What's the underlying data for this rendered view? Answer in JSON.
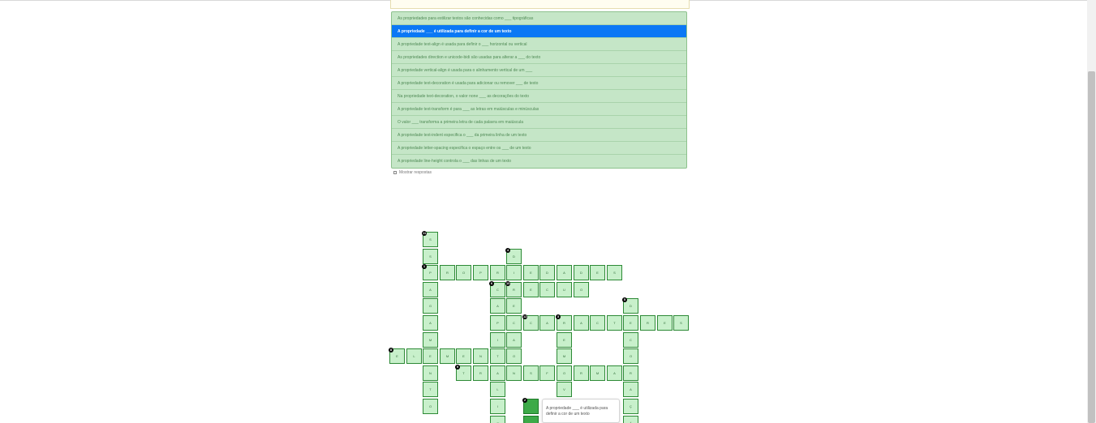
{
  "clues": [
    "As propriedades para estilizar textos são conhecidas como ___ tipográficas",
    "A propriedade ___ é utilizada para definir a cor de um texto",
    "A propriedade text-align é usada para definir o ___ horizontal ou vertical",
    "As propriedades direction e unicode-bidi são usadas para alterar a ___ do texto",
    "A propriedade vertical-align é usada para o alinhamento vertical de um ___",
    "A propriedade text-decoration é usada para adicionar ou remover ___ de texto",
    "Na propriedade text-decoration, o valor none ___ as decorações do texto",
    "A propriedade text-transform é para ___ as letras em maiúsculas e minúsculas",
    "O valor ___ transforma a primeira letra de cada palavra em maiúscula",
    "A propriedade text-indent especifica o ___ da primeira linha de um texto",
    "A propriedade letter-spacing especifica o espaço entre os ___ de um texto",
    "A propriedade line-height controla o ___ das linhas de um texto"
  ],
  "active_clue_index": 1,
  "show_answers_label": "Mostrar respostas",
  "tooltip_text": "A propriedade ___ é utilizada para definir a cor de um texto",
  "colors": {
    "cell_fill": "#c8f0cb",
    "cell_border": "#2d8a36",
    "active_clue": "#0b78f5",
    "focused_cell": "#3daa48"
  },
  "grid": {
    "cells": [
      {
        "c": 2,
        "r": 0,
        "ch": "S",
        "n": "11"
      },
      {
        "c": 2,
        "r": 1,
        "ch": "S"
      },
      {
        "c": 7,
        "r": 1,
        "ch": "D",
        "n": "4"
      },
      {
        "c": 2,
        "r": 2,
        "ch": "P",
        "n": "1"
      },
      {
        "c": 3,
        "r": 2,
        "ch": "R"
      },
      {
        "c": 4,
        "r": 2,
        "ch": "O"
      },
      {
        "c": 5,
        "r": 2,
        "ch": "P"
      },
      {
        "c": 6,
        "r": 2,
        "ch": "R"
      },
      {
        "c": 7,
        "r": 2,
        "ch": "I"
      },
      {
        "c": 8,
        "r": 2,
        "ch": "E"
      },
      {
        "c": 9,
        "r": 2,
        "ch": "D"
      },
      {
        "c": 10,
        "r": 2,
        "ch": "A"
      },
      {
        "c": 11,
        "r": 2,
        "ch": "D"
      },
      {
        "c": 12,
        "r": 2,
        "ch": "E"
      },
      {
        "c": 13,
        "r": 2,
        "ch": "S"
      },
      {
        "c": 2,
        "r": 3,
        "ch": "A"
      },
      {
        "c": 6,
        "r": 3,
        "ch": "C",
        "n": "6"
      },
      {
        "c": 7,
        "r": 3,
        "ch": "R",
        "n": "10"
      },
      {
        "c": 8,
        "r": 3,
        "ch": "E"
      },
      {
        "c": 9,
        "r": 3,
        "ch": "C"
      },
      {
        "c": 10,
        "r": 3,
        "ch": "U"
      },
      {
        "c": 11,
        "r": 3,
        "ch": "O"
      },
      {
        "c": 2,
        "r": 4,
        "ch": "G"
      },
      {
        "c": 6,
        "r": 4,
        "ch": "A"
      },
      {
        "c": 7,
        "r": 4,
        "ch": "E"
      },
      {
        "c": 14,
        "r": 4,
        "ch": "D",
        "n": "5"
      },
      {
        "c": 2,
        "r": 5,
        "ch": "A"
      },
      {
        "c": 6,
        "r": 5,
        "ch": "P"
      },
      {
        "c": 7,
        "r": 5,
        "ch": "C"
      },
      {
        "c": 8,
        "r": 5,
        "ch": "C",
        "n": "12"
      },
      {
        "c": 9,
        "r": 5,
        "ch": "A"
      },
      {
        "c": 10,
        "r": 5,
        "ch": "R",
        "n": "3"
      },
      {
        "c": 11,
        "r": 5,
        "ch": "A"
      },
      {
        "c": 12,
        "r": 5,
        "ch": "C"
      },
      {
        "c": 13,
        "r": 5,
        "ch": "T"
      },
      {
        "c": 14,
        "r": 5,
        "ch": "E"
      },
      {
        "c": 15,
        "r": 5,
        "ch": "R"
      },
      {
        "c": 16,
        "r": 5,
        "ch": "E"
      },
      {
        "c": 17,
        "r": 5,
        "ch": "S"
      },
      {
        "c": 2,
        "r": 6,
        "ch": "M"
      },
      {
        "c": 6,
        "r": 6,
        "ch": "I"
      },
      {
        "c": 7,
        "r": 6,
        "ch": "A"
      },
      {
        "c": 10,
        "r": 6,
        "ch": "E"
      },
      {
        "c": 14,
        "r": 6,
        "ch": "C"
      },
      {
        "c": 0,
        "r": 7,
        "ch": "E",
        "n": "8"
      },
      {
        "c": 1,
        "r": 7,
        "ch": "L"
      },
      {
        "c": 2,
        "r": 7,
        "ch": "E"
      },
      {
        "c": 3,
        "r": 7,
        "ch": "M"
      },
      {
        "c": 4,
        "r": 7,
        "ch": "E"
      },
      {
        "c": 5,
        "r": 7,
        "ch": "N"
      },
      {
        "c": 6,
        "r": 7,
        "ch": "T"
      },
      {
        "c": 7,
        "r": 7,
        "ch": "O"
      },
      {
        "c": 10,
        "r": 7,
        "ch": "M"
      },
      {
        "c": 14,
        "r": 7,
        "ch": "O"
      },
      {
        "c": 2,
        "r": 8,
        "ch": "N"
      },
      {
        "c": 4,
        "r": 8,
        "ch": "T",
        "n": "9"
      },
      {
        "c": 5,
        "r": 8,
        "ch": "R"
      },
      {
        "c": 6,
        "r": 8,
        "ch": "A"
      },
      {
        "c": 7,
        "r": 8,
        "ch": "N"
      },
      {
        "c": 8,
        "r": 8,
        "ch": "S"
      },
      {
        "c": 9,
        "r": 8,
        "ch": "F"
      },
      {
        "c": 10,
        "r": 8,
        "ch": "O"
      },
      {
        "c": 11,
        "r": 8,
        "ch": "R"
      },
      {
        "c": 12,
        "r": 8,
        "ch": "M"
      },
      {
        "c": 13,
        "r": 8,
        "ch": "A"
      },
      {
        "c": 14,
        "r": 8,
        "ch": "R"
      },
      {
        "c": 2,
        "r": 9,
        "ch": "T"
      },
      {
        "c": 6,
        "r": 9,
        "ch": "L"
      },
      {
        "c": 10,
        "r": 9,
        "ch": "V"
      },
      {
        "c": 14,
        "r": 9,
        "ch": "A"
      },
      {
        "c": 2,
        "r": 10,
        "ch": "O"
      },
      {
        "c": 6,
        "r": 10,
        "ch": "I"
      },
      {
        "c": 8,
        "r": 10,
        "ch": "",
        "n": "2",
        "focus": true
      },
      {
        "c": 14,
        "r": 10,
        "ch": "Ç"
      },
      {
        "c": 6,
        "r": 11,
        "ch": "Z"
      },
      {
        "c": 8,
        "r": 11,
        "ch": "",
        "focus": true
      },
      {
        "c": 14,
        "r": 11,
        "ch": "Ã"
      }
    ]
  }
}
